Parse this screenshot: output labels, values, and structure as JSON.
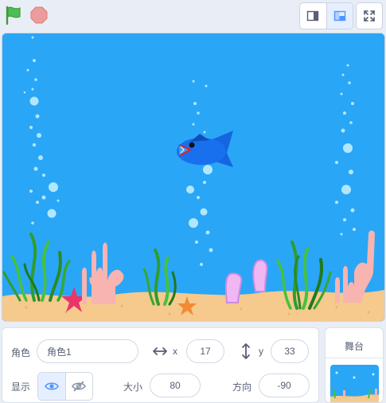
{
  "toolbar": {
    "green_flag_icon": "green-flag",
    "stop_icon": "stop-sign",
    "layout_small": "small-stage-mode",
    "layout_normal": "normal-stage-mode",
    "fullscreen_icon": "fullscreen"
  },
  "stage": {
    "sprite": "blue-fish",
    "colors": {
      "water": "#2aa6f6",
      "sand": "#f6c98d",
      "fish": "#1565e0"
    }
  },
  "sprite_info": {
    "sprite_label": "角色",
    "sprite_name": "角色1",
    "x_label": "x",
    "x_value": "17",
    "y_label": "y",
    "y_value": "33",
    "show_label": "显示",
    "size_label": "大小",
    "size_value": "80",
    "direction_label": "方向",
    "direction_value": "-90"
  },
  "stage_selector": {
    "title": "舞台"
  }
}
